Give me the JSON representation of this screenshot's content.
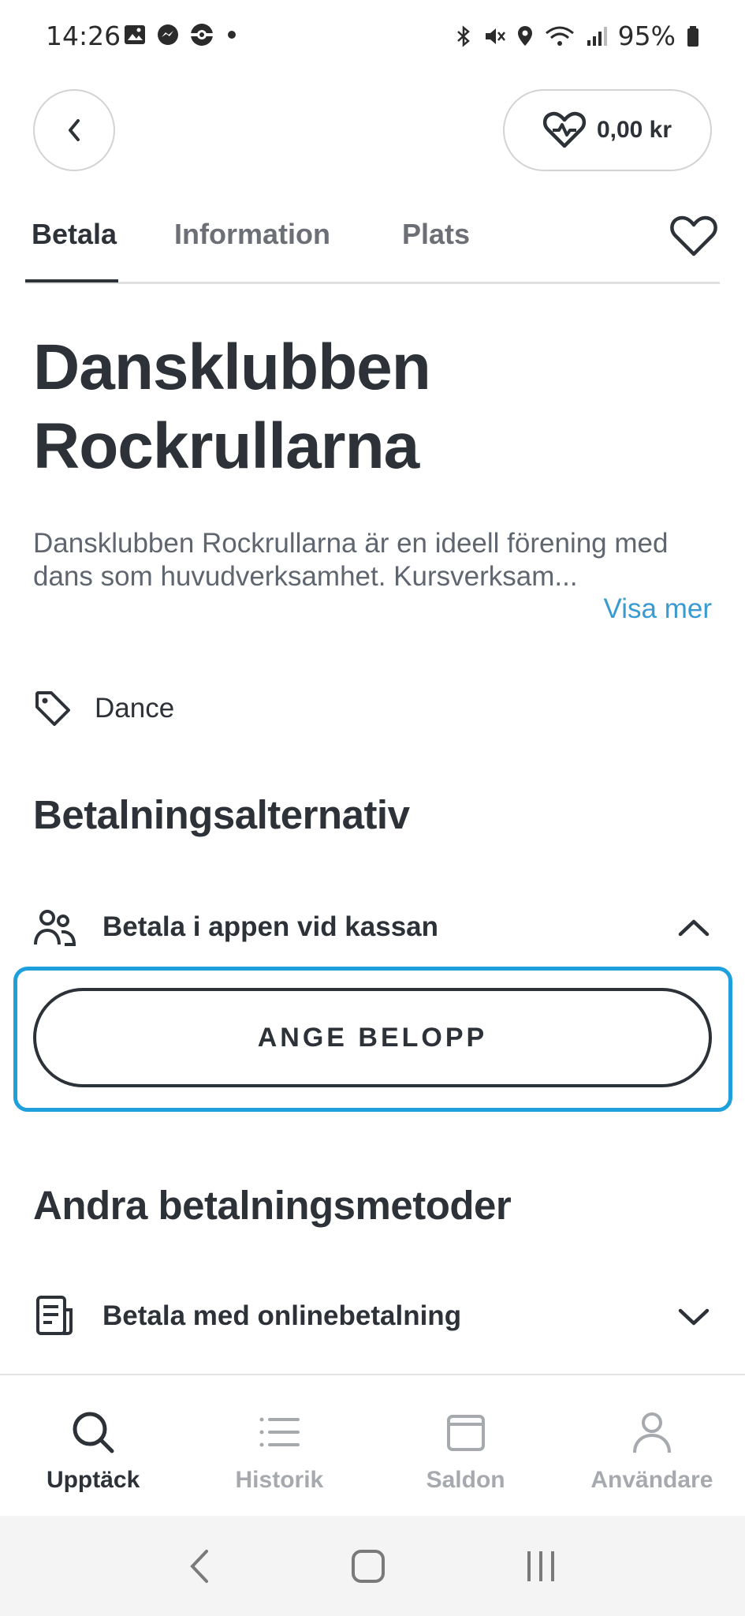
{
  "status_bar": {
    "time": "14:26",
    "battery": "95%",
    "left_icons": [
      "image-icon",
      "messenger-icon",
      "pokeball-icon",
      "dot-icon"
    ],
    "right_icons": [
      "bluetooth-icon",
      "mute-icon",
      "location-icon",
      "wifi-icon",
      "signal-icon",
      "battery-icon"
    ]
  },
  "header": {
    "back_icon": "chevron-left-icon",
    "wallet_icon": "heart-pulse-icon",
    "wallet_amount": "0,00 kr"
  },
  "tabs": [
    {
      "label": "Betala",
      "active": true
    },
    {
      "label": "Information",
      "active": false
    },
    {
      "label": "Plats",
      "active": false
    }
  ],
  "favorite_icon": "heart-outline-icon",
  "organization": {
    "name_line1": "Dansklubben",
    "name_line2": "Rockrullarna",
    "description": "Dansklubben Rockrullarna är en ideell förening med dans som huvudverksamhet. Kursverksam...",
    "show_more": "Visa mer",
    "category": "Dance"
  },
  "payment_options": {
    "title": "Betalningsalternativ",
    "option_label": "Betala i appen vid kassan",
    "amount_button": "ANGE BELOPP"
  },
  "other_methods": {
    "title": "Andra betalningsmetoder",
    "option_label": "Betala med onlinebetalning"
  },
  "bottom_nav": [
    {
      "label": "Upptäck",
      "icon": "search-icon",
      "active": true
    },
    {
      "label": "Historik",
      "icon": "list-icon",
      "active": false
    },
    {
      "label": "Saldon",
      "icon": "wallet-icon",
      "active": false
    },
    {
      "label": "Användare",
      "icon": "user-icon",
      "active": false
    }
  ],
  "colors": {
    "text": "#2d3138",
    "muted": "#6c6f75",
    "link": "#3a9bd1",
    "focus": "#1ea0dd"
  }
}
